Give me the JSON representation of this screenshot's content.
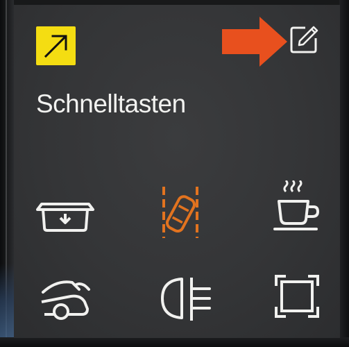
{
  "panel": {
    "title": "Schnelltasten"
  },
  "header": {
    "expand_button_icon": "arrow-up-right-icon",
    "edit_button_icon": "edit-pencil-icon",
    "annotation_arrow_color": "#e8501e"
  },
  "colors": {
    "panel_background": "#353638",
    "accent_yellow": "#f4dd12",
    "active_orange": "#e2731f",
    "icon_white": "#f1f1ef",
    "title_text": "#f2f2f0"
  },
  "shortcuts": [
    {
      "icon": "tailgate-open-icon",
      "active": false
    },
    {
      "icon": "lane-keeping-assist-icon",
      "active": true
    },
    {
      "icon": "coffee-break-icon",
      "active": false
    },
    {
      "icon": "trunk-lid-icon",
      "active": false
    },
    {
      "icon": "rear-fog-light-icon",
      "active": false
    },
    {
      "icon": "fullscreen-frame-icon",
      "active": false
    }
  ]
}
